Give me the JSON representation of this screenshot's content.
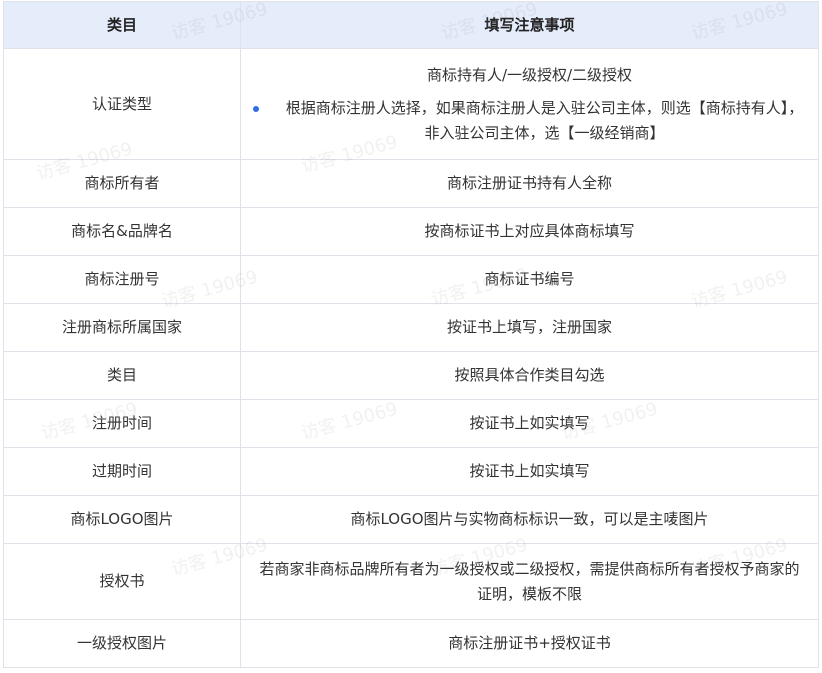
{
  "table": {
    "headers": [
      "类目",
      "填写注意事项"
    ],
    "rows": [
      {
        "label": "认证类型",
        "value": "商标持有人/一级授权/二级授权",
        "note": "根据商标注册人选择，如果商标注册人是入驻公司主体，则选【商标持有人】，非入驻公司主体，选【一级经销商】"
      },
      {
        "label": "商标所有者",
        "value": "商标注册证书持有人全称"
      },
      {
        "label": "商标名&品牌名",
        "value": "按商标证书上对应具体商标填写"
      },
      {
        "label": "商标注册号",
        "value": "商标证书编号"
      },
      {
        "label": "注册商标所属国家",
        "value": "按证书上填写，注册国家"
      },
      {
        "label": "类目",
        "value": "按照具体合作类目勾选"
      },
      {
        "label": "注册时间",
        "value": "按证书上如实填写"
      },
      {
        "label": "过期时间",
        "value": "按证书上如实填写"
      },
      {
        "label": "商标LOGO图片",
        "value": "商标LOGO图片与实物商标标识一致，可以是主唛图片"
      },
      {
        "label": "授权书",
        "value": "若商家非商标品牌所有者为一级授权或二级授权，需提供商标所有者授权予商家的证明，模板不限"
      },
      {
        "label": "一级授权图片",
        "value": "商标注册证书+授权证书"
      }
    ]
  },
  "watermark": {
    "text": "访客 19069"
  },
  "colors": {
    "header_bg": "#e5ecfa",
    "border": "#dfe2e8",
    "bullet": "#2f6fe4"
  }
}
